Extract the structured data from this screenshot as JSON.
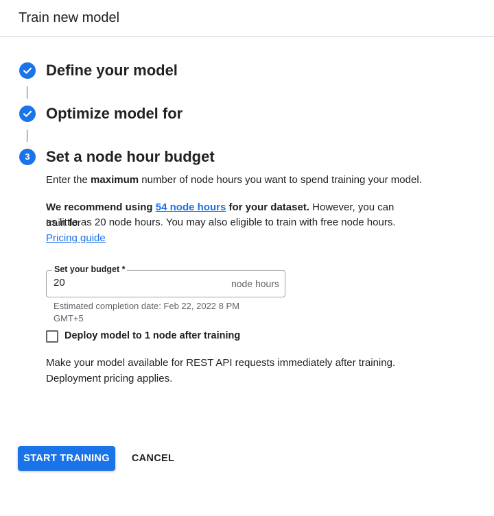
{
  "header": {
    "title": "Train new model"
  },
  "steps": [
    {
      "title": "Define your model",
      "status": "complete"
    },
    {
      "title": "Optimize model for",
      "status": "complete"
    },
    {
      "number": "3",
      "title": "Set a node hour budget",
      "status": "active"
    }
  ],
  "budget": {
    "intro_pre": "Enter the ",
    "intro_bold": "maximum",
    "intro_post": " number of node hours you want to spend training your model.",
    "rec_bold_pre": "We recommend using ",
    "rec_link": "54 node hours",
    "rec_bold_post": " for your dataset.",
    "rec_rest_1": " However, you can train for",
    "rec_rest_2": "as little as 20 node hours. You may also eligible to train with free node hours.",
    "pricing_link": "Pricing guide",
    "field_label": "Set your budget *",
    "field_value": "20",
    "field_suffix": "node hours",
    "hint_line1": "Estimated completion date: Feb 22, 2022 8 PM",
    "hint_line2": "GMT+5",
    "checkbox_label": "Deploy model to 1 node after training",
    "checkbox_checked": false,
    "deploy_line1": "Make your model available for REST API requests immediately after training.",
    "deploy_line2": "Deployment pricing applies."
  },
  "actions": {
    "primary": "START TRAINING",
    "secondary": "CANCEL"
  },
  "colors": {
    "accent": "#1a73e8",
    "text": "#202124",
    "muted": "#5f6368"
  },
  "icons": {
    "complete": "check-circle-icon"
  }
}
